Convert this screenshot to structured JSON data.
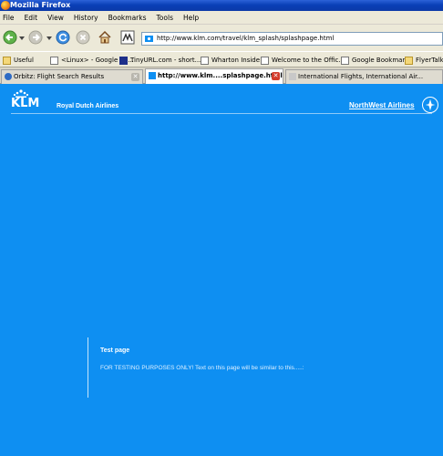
{
  "window": {
    "title": "Mozilla Firefox"
  },
  "menu": [
    "File",
    "Edit",
    "View",
    "History",
    "Bookmarks",
    "Tools",
    "Help"
  ],
  "navbar": {
    "url": "http://www.klm.com/travel/klm_splash/splashpage.html"
  },
  "bookmarks": [
    {
      "label": "Useful",
      "icon": "folder-icon"
    },
    {
      "label": "<Linux> - Google Se...",
      "icon": "google-icon"
    },
    {
      "label": "TinyURL.com - short...",
      "icon": "tinyurl-icon"
    },
    {
      "label": "Wharton Inside",
      "icon": "page-icon"
    },
    {
      "label": "Welcome to the Offic...",
      "icon": "page-icon"
    },
    {
      "label": "Google Bookmark",
      "icon": "page-icon"
    },
    {
      "label": "FlyerTalk",
      "icon": "folder-icon"
    }
  ],
  "tabs": [
    {
      "label": "Orbitz: Flight Search Results",
      "active": false
    },
    {
      "label": "http://www.klm....splashpage.html",
      "active": true
    },
    {
      "label": "International Flights, International Air...",
      "active": false
    }
  ],
  "page": {
    "logo_text": "KLM",
    "logo_subtitle": "Royal Dutch Airlines",
    "partner_link": "NorthWest Airlines",
    "test_title": "Test page",
    "test_text": "FOR TESTING PURPOSES ONLY! Text on this page will be similar to this.....:"
  },
  "colors": {
    "page_background": "#0e8ff2",
    "chrome": "#ece9d8",
    "titlebar": "#0a3fb7",
    "text_on_page": "#ffffff"
  }
}
